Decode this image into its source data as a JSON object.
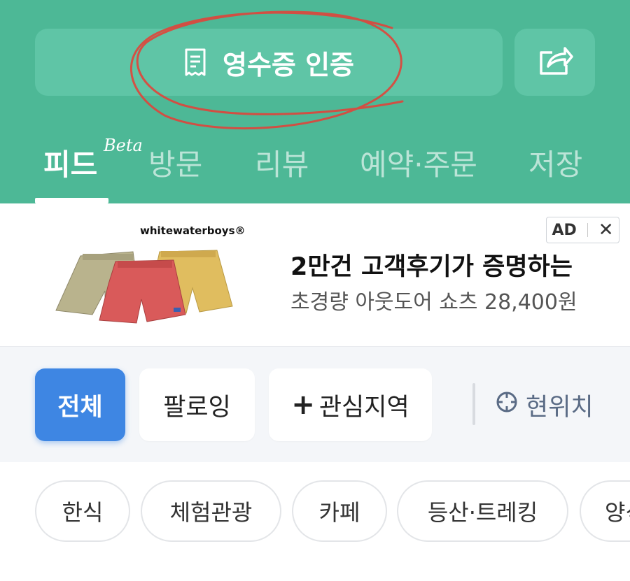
{
  "header": {
    "receipt_button_label": "영수증 인증",
    "icons": {
      "receipt": "receipt-icon",
      "share": "share-icon"
    },
    "colors": {
      "background": "#4db896",
      "button": "#5fc5a6",
      "annotation": "#e0443a"
    }
  },
  "tabs": [
    {
      "label": "피드",
      "badge": "Beta",
      "active": true
    },
    {
      "label": "방문",
      "active": false
    },
    {
      "label": "리뷰",
      "active": false
    },
    {
      "label": "예약·주문",
      "active": false
    },
    {
      "label": "저장",
      "active": false
    }
  ],
  "ad": {
    "brand": "whitewaterboys®",
    "badge_label": "AD",
    "close_symbol": "✕",
    "headline": "2만건 고객후기가 증명하는",
    "subline": "초경량 아웃도어 쇼츠 28,400원"
  },
  "filters": {
    "all": "전체",
    "following": "팔로잉",
    "interest_plus": "+",
    "interest_region": "관심지역",
    "current_location": "현위치",
    "colors": {
      "active": "#3e86e3"
    }
  },
  "categories": [
    "한식",
    "체험관광",
    "카페",
    "등산·트레킹",
    "양식"
  ]
}
